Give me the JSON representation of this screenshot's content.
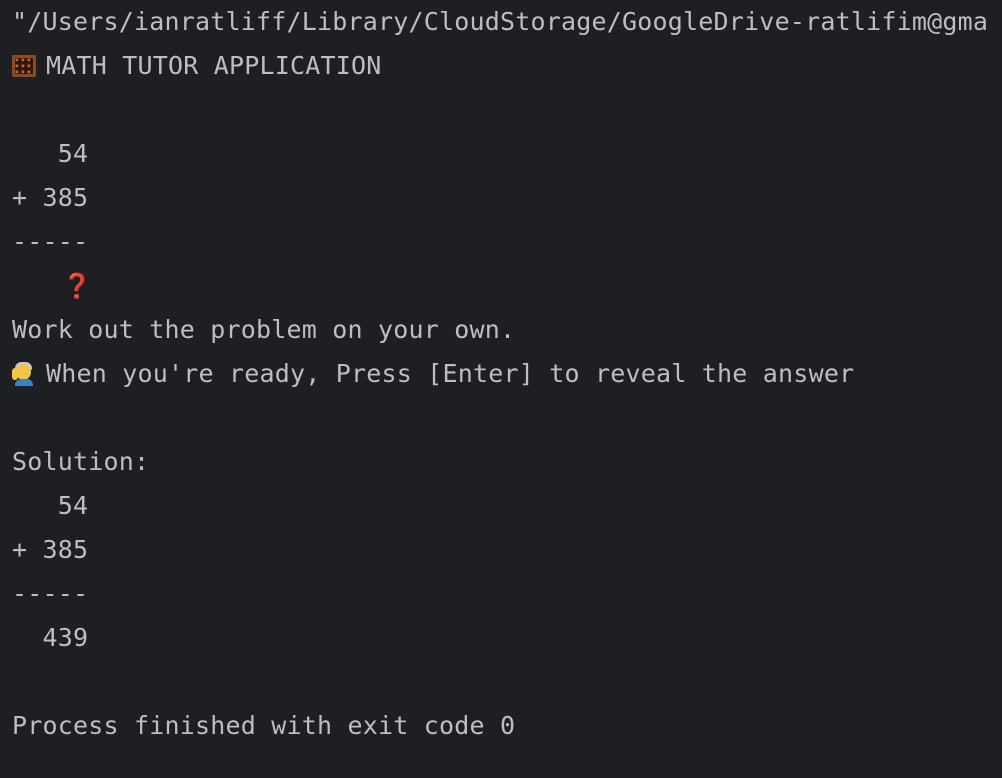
{
  "console": {
    "command_line": "\"/Users/ianratliff/Library/CloudStorage/GoogleDrive-ratlifim@gma",
    "app_title": "MATH TUTOR APPLICATION",
    "problem": {
      "top": "   54",
      "bottom": "+ 385",
      "rule": "-----",
      "question_mark": "❓"
    },
    "instruction": "Work out the problem on your own.",
    "prompt": "When you're ready, Press [Enter] to reveal the answer",
    "solution": {
      "label": "Solution:",
      "top": "   54",
      "bottom": "+ 385",
      "rule": "-----",
      "answer": "  439"
    },
    "exit_message": "Process finished with exit code 0"
  },
  "icons": {
    "title_icon": "abacus-icon",
    "prompt_icon": "raising-hand-person-icon"
  },
  "colors": {
    "background": "#1e1f22",
    "text": "#bcbec4",
    "question_mark": "#e5343d"
  }
}
